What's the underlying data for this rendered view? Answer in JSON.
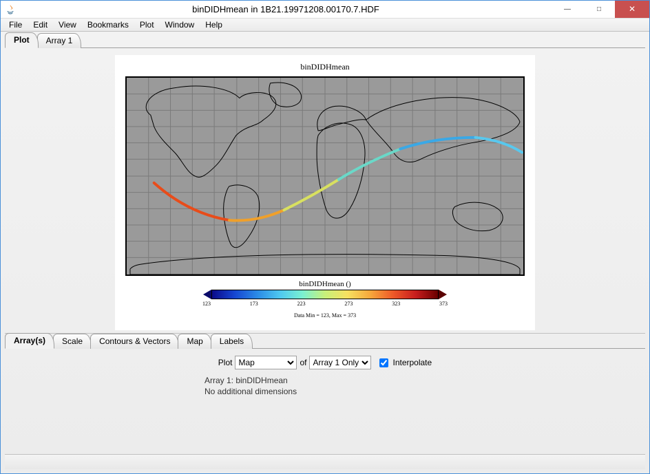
{
  "window": {
    "title": "binDIDHmean in 1B21.19971208.00170.7.HDF"
  },
  "menu": {
    "items": [
      "File",
      "Edit",
      "View",
      "Bookmarks",
      "Plot",
      "Window",
      "Help"
    ]
  },
  "top_tabs": {
    "items": [
      "Plot",
      "Array 1"
    ],
    "active": 0
  },
  "plot": {
    "title": "binDIDHmean",
    "colorbar_label": "binDIDHmean ()",
    "ticks": [
      "123",
      "173",
      "223",
      "273",
      "323",
      "373"
    ],
    "data_range": "Data Min = 123, Max = 373"
  },
  "bottom_tabs": {
    "items": [
      "Array(s)",
      "Scale",
      "Contours & Vectors",
      "Map",
      "Labels"
    ],
    "active": 0
  },
  "controls": {
    "plot_label": "Plot",
    "plot_type_selected": "Map",
    "plot_type_options": [
      "Map"
    ],
    "of_label": "of",
    "of_selected": "Array 1 Only",
    "of_options": [
      "Array 1 Only"
    ],
    "interpolate_label": "Interpolate",
    "interpolate_checked": true,
    "array_line": "Array 1: binDIDHmean",
    "nodim_line": "No additional dimensions"
  },
  "chart_data": {
    "type": "heatmap",
    "title": "binDIDHmean",
    "xlabel": "",
    "ylabel": "",
    "colorbar_label": "binDIDHmean ()",
    "colorbar_ticks": [
      123,
      173,
      223,
      273,
      323,
      373
    ],
    "data_min": 123,
    "data_max": 373,
    "projection": "global map",
    "note": "Single satellite orbit swath overlaid on world coastlines; warm values near South America, cooler values across Asia/Pacific."
  }
}
